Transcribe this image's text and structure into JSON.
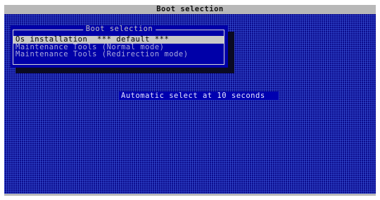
{
  "header": {
    "title": "Boot selection"
  },
  "dialog": {
    "title": "Boot selection",
    "items": [
      {
        "label": "Os installation  *** default ***",
        "selected": true
      },
      {
        "label": "Maintenance Tools (Normal mode)",
        "selected": false
      },
      {
        "label": "Maintenance Tools (Redirection mode)",
        "selected": false
      }
    ]
  },
  "status": {
    "auto_select": "Automatic select at 10 seconds"
  },
  "colors": {
    "background": "#0b0b8c",
    "dialog": "#0000a8",
    "bar": "#b8b8b8",
    "highlight": "#c8c8c8"
  }
}
